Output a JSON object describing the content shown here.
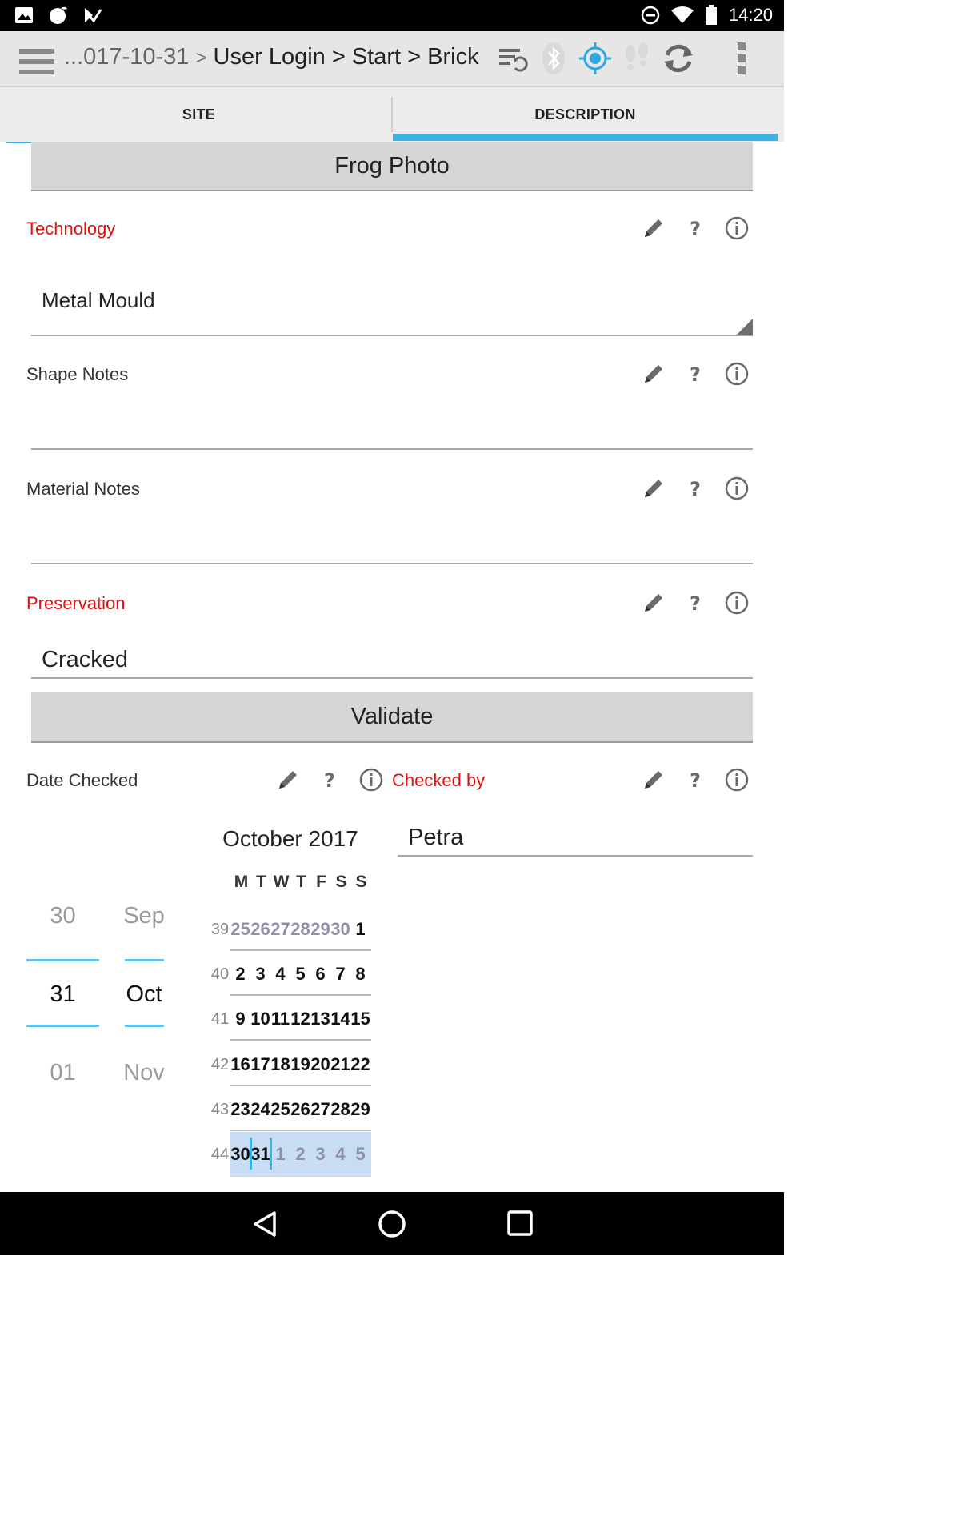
{
  "status_bar": {
    "time": "14:20"
  },
  "toolbar": {
    "breadcrumb": [
      {
        "text": "...017-10-31",
        "dim": true
      },
      {
        "text": "User Login"
      },
      {
        "text": "Start"
      },
      {
        "text": "Brick"
      }
    ],
    "icons": [
      "menu-icon",
      "sync-list-icon",
      "bluetooth-icon",
      "gps-icon",
      "footsteps-icon",
      "refresh-icon",
      "overflow-icon"
    ]
  },
  "tabs": [
    {
      "label": "SITE",
      "active": false
    },
    {
      "label": "DESCRIPTION",
      "active": true
    }
  ],
  "form": {
    "frog_photo_button": "Frog Photo",
    "technology": {
      "label": "Technology",
      "required": true,
      "value": "Metal Mould"
    },
    "shape_notes": {
      "label": "Shape Notes",
      "required": false,
      "value": ""
    },
    "material_notes": {
      "label": "Material Notes",
      "required": false,
      "value": ""
    },
    "preservation": {
      "label": "Preservation",
      "required": true,
      "value": "Cracked"
    },
    "validate_button": "Validate",
    "date_checked": {
      "label": "Date Checked",
      "picker": {
        "day": {
          "prev": "30",
          "current": "31",
          "next": "01"
        },
        "month": {
          "prev": "Sep",
          "current": "Oct",
          "next": "Nov"
        }
      },
      "calendar": {
        "title": "October 2017",
        "weekday_headers": [
          "M",
          "T",
          "W",
          "T",
          "F",
          "S",
          "S"
        ],
        "weeks": [
          {
            "week": "39",
            "days": [
              "25",
              "26",
              "27",
              "28",
              "29",
              "30",
              "1"
            ],
            "out_of_month": [
              true,
              true,
              true,
              true,
              true,
              true,
              false
            ]
          },
          {
            "week": "40",
            "days": [
              "2",
              "3",
              "4",
              "5",
              "6",
              "7",
              "8"
            ],
            "out_of_month": [
              false,
              false,
              false,
              false,
              false,
              false,
              false
            ]
          },
          {
            "week": "41",
            "days": [
              "9",
              "10",
              "11",
              "12",
              "13",
              "14",
              "15"
            ],
            "out_of_month": [
              false,
              false,
              false,
              false,
              false,
              false,
              false
            ]
          },
          {
            "week": "42",
            "days": [
              "16",
              "17",
              "18",
              "19",
              "20",
              "21",
              "22"
            ],
            "out_of_month": [
              false,
              false,
              false,
              false,
              false,
              false,
              false
            ]
          },
          {
            "week": "43",
            "days": [
              "23",
              "24",
              "25",
              "26",
              "27",
              "28",
              "29"
            ],
            "out_of_month": [
              false,
              false,
              false,
              false,
              false,
              false,
              false
            ]
          },
          {
            "week": "44",
            "days": [
              "30",
              "31",
              "1",
              "2",
              "3",
              "4",
              "5"
            ],
            "out_of_month": [
              false,
              false,
              true,
              true,
              true,
              true,
              true
            ]
          }
        ],
        "selected_day": "31"
      }
    },
    "checked_by": {
      "label": "Checked by",
      "required": true,
      "value": "Petra"
    }
  },
  "colors": {
    "accent": "#39b4e6",
    "required_label": "#e01010",
    "toolbar_bg": "#e6e6e6"
  }
}
